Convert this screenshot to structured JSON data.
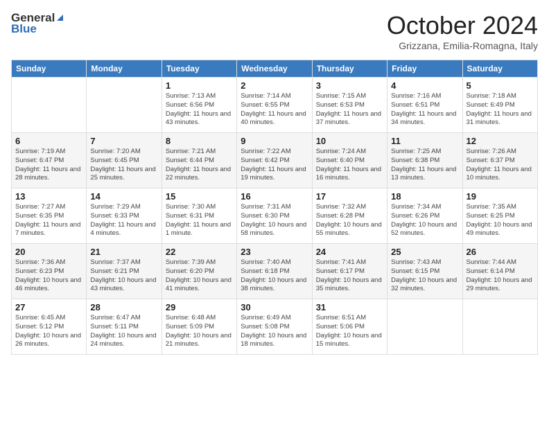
{
  "header": {
    "logo_general": "General",
    "logo_blue": "Blue",
    "month": "October 2024",
    "location": "Grizzana, Emilia-Romagna, Italy"
  },
  "columns": [
    "Sunday",
    "Monday",
    "Tuesday",
    "Wednesday",
    "Thursday",
    "Friday",
    "Saturday"
  ],
  "weeks": [
    [
      {
        "num": "",
        "sunrise": "",
        "sunset": "",
        "daylight": ""
      },
      {
        "num": "",
        "sunrise": "",
        "sunset": "",
        "daylight": ""
      },
      {
        "num": "1",
        "sunrise": "Sunrise: 7:13 AM",
        "sunset": "Sunset: 6:56 PM",
        "daylight": "Daylight: 11 hours and 43 minutes."
      },
      {
        "num": "2",
        "sunrise": "Sunrise: 7:14 AM",
        "sunset": "Sunset: 6:55 PM",
        "daylight": "Daylight: 11 hours and 40 minutes."
      },
      {
        "num": "3",
        "sunrise": "Sunrise: 7:15 AM",
        "sunset": "Sunset: 6:53 PM",
        "daylight": "Daylight: 11 hours and 37 minutes."
      },
      {
        "num": "4",
        "sunrise": "Sunrise: 7:16 AM",
        "sunset": "Sunset: 6:51 PM",
        "daylight": "Daylight: 11 hours and 34 minutes."
      },
      {
        "num": "5",
        "sunrise": "Sunrise: 7:18 AM",
        "sunset": "Sunset: 6:49 PM",
        "daylight": "Daylight: 11 hours and 31 minutes."
      }
    ],
    [
      {
        "num": "6",
        "sunrise": "Sunrise: 7:19 AM",
        "sunset": "Sunset: 6:47 PM",
        "daylight": "Daylight: 11 hours and 28 minutes."
      },
      {
        "num": "7",
        "sunrise": "Sunrise: 7:20 AM",
        "sunset": "Sunset: 6:45 PM",
        "daylight": "Daylight: 11 hours and 25 minutes."
      },
      {
        "num": "8",
        "sunrise": "Sunrise: 7:21 AM",
        "sunset": "Sunset: 6:44 PM",
        "daylight": "Daylight: 11 hours and 22 minutes."
      },
      {
        "num": "9",
        "sunrise": "Sunrise: 7:22 AM",
        "sunset": "Sunset: 6:42 PM",
        "daylight": "Daylight: 11 hours and 19 minutes."
      },
      {
        "num": "10",
        "sunrise": "Sunrise: 7:24 AM",
        "sunset": "Sunset: 6:40 PM",
        "daylight": "Daylight: 11 hours and 16 minutes."
      },
      {
        "num": "11",
        "sunrise": "Sunrise: 7:25 AM",
        "sunset": "Sunset: 6:38 PM",
        "daylight": "Daylight: 11 hours and 13 minutes."
      },
      {
        "num": "12",
        "sunrise": "Sunrise: 7:26 AM",
        "sunset": "Sunset: 6:37 PM",
        "daylight": "Daylight: 11 hours and 10 minutes."
      }
    ],
    [
      {
        "num": "13",
        "sunrise": "Sunrise: 7:27 AM",
        "sunset": "Sunset: 6:35 PM",
        "daylight": "Daylight: 11 hours and 7 minutes."
      },
      {
        "num": "14",
        "sunrise": "Sunrise: 7:29 AM",
        "sunset": "Sunset: 6:33 PM",
        "daylight": "Daylight: 11 hours and 4 minutes."
      },
      {
        "num": "15",
        "sunrise": "Sunrise: 7:30 AM",
        "sunset": "Sunset: 6:31 PM",
        "daylight": "Daylight: 11 hours and 1 minute."
      },
      {
        "num": "16",
        "sunrise": "Sunrise: 7:31 AM",
        "sunset": "Sunset: 6:30 PM",
        "daylight": "Daylight: 10 hours and 58 minutes."
      },
      {
        "num": "17",
        "sunrise": "Sunrise: 7:32 AM",
        "sunset": "Sunset: 6:28 PM",
        "daylight": "Daylight: 10 hours and 55 minutes."
      },
      {
        "num": "18",
        "sunrise": "Sunrise: 7:34 AM",
        "sunset": "Sunset: 6:26 PM",
        "daylight": "Daylight: 10 hours and 52 minutes."
      },
      {
        "num": "19",
        "sunrise": "Sunrise: 7:35 AM",
        "sunset": "Sunset: 6:25 PM",
        "daylight": "Daylight: 10 hours and 49 minutes."
      }
    ],
    [
      {
        "num": "20",
        "sunrise": "Sunrise: 7:36 AM",
        "sunset": "Sunset: 6:23 PM",
        "daylight": "Daylight: 10 hours and 46 minutes."
      },
      {
        "num": "21",
        "sunrise": "Sunrise: 7:37 AM",
        "sunset": "Sunset: 6:21 PM",
        "daylight": "Daylight: 10 hours and 43 minutes."
      },
      {
        "num": "22",
        "sunrise": "Sunrise: 7:39 AM",
        "sunset": "Sunset: 6:20 PM",
        "daylight": "Daylight: 10 hours and 41 minutes."
      },
      {
        "num": "23",
        "sunrise": "Sunrise: 7:40 AM",
        "sunset": "Sunset: 6:18 PM",
        "daylight": "Daylight: 10 hours and 38 minutes."
      },
      {
        "num": "24",
        "sunrise": "Sunrise: 7:41 AM",
        "sunset": "Sunset: 6:17 PM",
        "daylight": "Daylight: 10 hours and 35 minutes."
      },
      {
        "num": "25",
        "sunrise": "Sunrise: 7:43 AM",
        "sunset": "Sunset: 6:15 PM",
        "daylight": "Daylight: 10 hours and 32 minutes."
      },
      {
        "num": "26",
        "sunrise": "Sunrise: 7:44 AM",
        "sunset": "Sunset: 6:14 PM",
        "daylight": "Daylight: 10 hours and 29 minutes."
      }
    ],
    [
      {
        "num": "27",
        "sunrise": "Sunrise: 6:45 AM",
        "sunset": "Sunset: 5:12 PM",
        "daylight": "Daylight: 10 hours and 26 minutes."
      },
      {
        "num": "28",
        "sunrise": "Sunrise: 6:47 AM",
        "sunset": "Sunset: 5:11 PM",
        "daylight": "Daylight: 10 hours and 24 minutes."
      },
      {
        "num": "29",
        "sunrise": "Sunrise: 6:48 AM",
        "sunset": "Sunset: 5:09 PM",
        "daylight": "Daylight: 10 hours and 21 minutes."
      },
      {
        "num": "30",
        "sunrise": "Sunrise: 6:49 AM",
        "sunset": "Sunset: 5:08 PM",
        "daylight": "Daylight: 10 hours and 18 minutes."
      },
      {
        "num": "31",
        "sunrise": "Sunrise: 6:51 AM",
        "sunset": "Sunset: 5:06 PM",
        "daylight": "Daylight: 10 hours and 15 minutes."
      },
      {
        "num": "",
        "sunrise": "",
        "sunset": "",
        "daylight": ""
      },
      {
        "num": "",
        "sunrise": "",
        "sunset": "",
        "daylight": ""
      }
    ]
  ]
}
